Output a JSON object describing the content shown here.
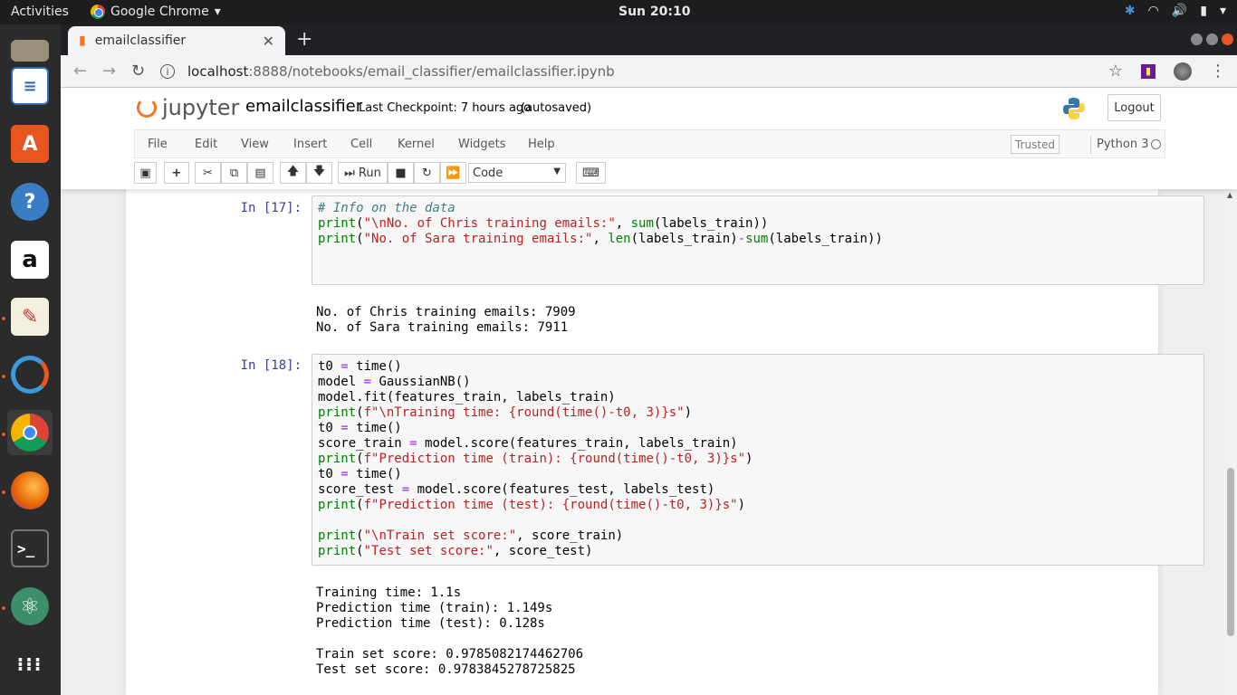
{
  "topbar": {
    "activities": "Activities",
    "app_name": "Google Chrome",
    "clock": "Sun 20:10"
  },
  "browser": {
    "tab_title": "emailclassifier",
    "url_host": "localhost",
    "url_rest": ":8888/notebooks/email_classifier/emailclassifier.ipynb"
  },
  "jupyter": {
    "logo_text": "jupyter",
    "notebook_name": "emailclassifier",
    "checkpoint": "Last Checkpoint: 7 hours ago",
    "autosave": "(autosaved)",
    "logout": "Logout",
    "menu": [
      "File",
      "Edit",
      "View",
      "Insert",
      "Cell",
      "Kernel",
      "Widgets",
      "Help"
    ],
    "trusted": "Trusted",
    "kernel": "Python 3",
    "run_label": "Run",
    "cell_type": "Code"
  },
  "cells": {
    "c17": {
      "prompt": "In [17]:",
      "output": "No. of Chris training emails: 7909\nNo. of Sara training emails: 7911"
    },
    "c18": {
      "prompt": "In [18]:",
      "output": "Training time: 1.1s\nPrediction time (train): 1.149s\nPrediction time (test): 0.128s\n\nTrain set score: 0.9785082174462706\nTest set score: 0.9783845278725825"
    }
  },
  "colors": {
    "jupyter_orange": "#f37726",
    "prompt_blue": "#303f9f",
    "keyword_green": "#008000",
    "string_red": "#ba2121"
  }
}
